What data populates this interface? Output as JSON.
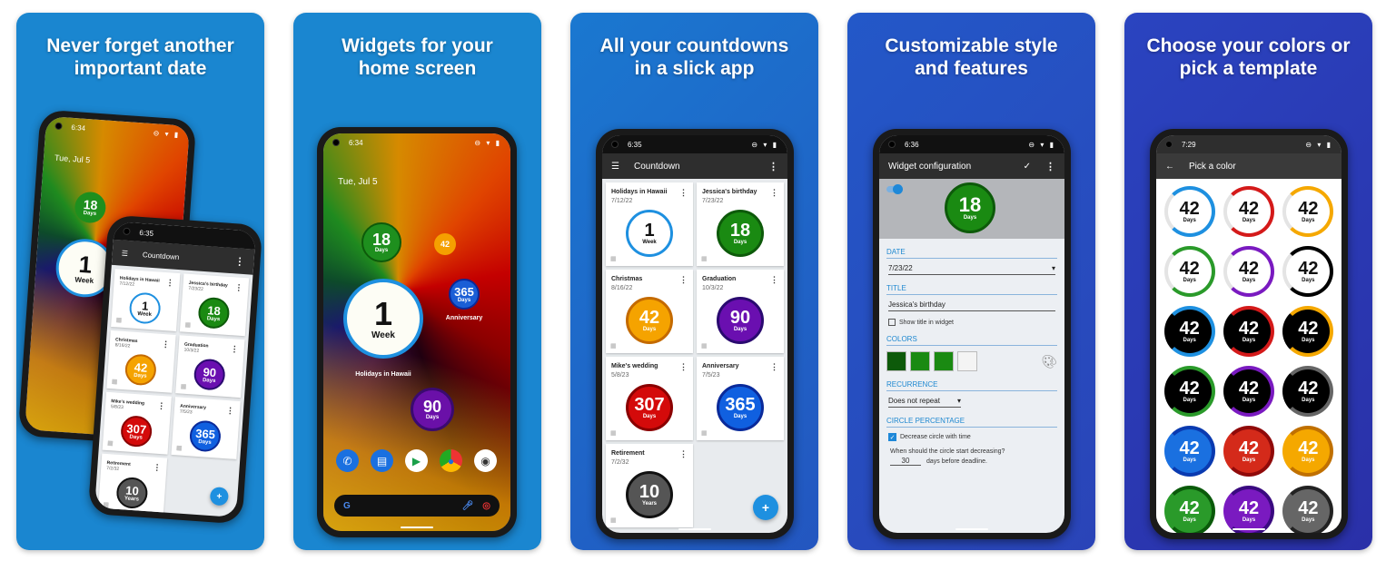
{
  "panels": [
    {
      "title": "Never forget another\nimportant date",
      "bg": "#1a86d0"
    },
    {
      "title": "Widgets for your\nhome screen",
      "bg": "#1a86d0"
    },
    {
      "title": "All your countdowns\nin a slick app",
      "bg": "#1f6fcc"
    },
    {
      "title": "Customizable style\nand features",
      "bg": "#2650c4"
    },
    {
      "title": "Choose your colors or\npick a template",
      "bg": "#2a3cb6"
    }
  ],
  "home": {
    "time": "6:34",
    "status_icons": "⊖ ▾ ▮",
    "date": "Tue, Jul 5",
    "widgets": [
      {
        "value": "18",
        "unit": "Days",
        "color": "#1e8f1e"
      },
      {
        "value": "42",
        "unit": "Days",
        "color": "#f5a000"
      },
      {
        "value": "1",
        "unit": "Week",
        "color": "#fdfdf5",
        "label": "Holidays in Hawaii"
      },
      {
        "value": "365",
        "unit": "Days",
        "color": "#1a5ed6",
        "label": "Anniversary"
      },
      {
        "value": "90",
        "unit": "Days",
        "color": "#6a10a8"
      }
    ],
    "dock": [
      "phone-icon",
      "messages-icon",
      "play-store-icon",
      "chrome-icon",
      "camera-icon"
    ]
  },
  "app": {
    "time": "6:35",
    "title": "Countdown",
    "menu_icon": "☰",
    "more_icon": "⋮",
    "fab": "+",
    "cards": [
      {
        "title": "Holidays in Hawaii",
        "date": "7/12/22",
        "value": "1",
        "unit": "Week",
        "color": "#ffffff",
        "ring": "#1e90e0",
        "text": "#111"
      },
      {
        "title": "Jessica's birthday",
        "date": "7/23/22",
        "value": "18",
        "unit": "Days",
        "color": "#1a8a12",
        "ring": "#0d5a0a",
        "text": "#fff"
      },
      {
        "title": "Christmas",
        "date": "8/16/22",
        "value": "42",
        "unit": "Days",
        "color": "#f5a300",
        "ring": "#c46a00",
        "text": "#fff"
      },
      {
        "title": "Graduation",
        "date": "10/3/22",
        "value": "90",
        "unit": "Days",
        "color": "#6a0fb0",
        "ring": "#2a0a70",
        "text": "#fff"
      },
      {
        "title": "Mike's wedding",
        "date": "5/8/23",
        "value": "307",
        "unit": "Days",
        "color": "#d40a0a",
        "ring": "#8a0000",
        "text": "#fff"
      },
      {
        "title": "Anniversary",
        "date": "7/5/23",
        "value": "365",
        "unit": "Days",
        "color": "#1060e0",
        "ring": "#0a2a9a",
        "text": "#fff"
      },
      {
        "title": "Retirement",
        "date": "7/2/32",
        "value": "10",
        "unit": "Years",
        "color": "#555555",
        "ring": "#111",
        "text": "#fff"
      }
    ]
  },
  "config": {
    "time": "6:36",
    "title": "Widget configuration",
    "check_icon": "✓",
    "more_icon": "⋮",
    "preview": {
      "value": "18",
      "unit": "Days",
      "color": "#1a8a12"
    },
    "date_label": "DATE",
    "date_value": "7/23/22",
    "title_label": "TITLE",
    "title_value": "Jessica's birthday",
    "show_title": "Show title in widget",
    "colors_label": "COLORS",
    "swatches": [
      "#0d5a0a",
      "#1a8a12",
      "#1a8a12",
      "#f4f4f4"
    ],
    "recurrence_label": "RECURRENCE",
    "recurrence_value": "Does not repeat",
    "circle_label": "CIRCLE PERCENTAGE",
    "decrease_label": "Decrease circle with time",
    "question": "When should the circle start decreasing?",
    "days_value": "30",
    "days_suffix": "days before deadline."
  },
  "picker": {
    "time": "7:29",
    "title": "Pick a color",
    "back_icon": "←",
    "items": [
      {
        "value": "42",
        "unit": "Days",
        "bg": "#ffffff",
        "ring": "#1e90e0",
        "text": "#111"
      },
      {
        "value": "42",
        "unit": "Days",
        "bg": "#ffffff",
        "ring": "#d41a1a",
        "text": "#111"
      },
      {
        "value": "42",
        "unit": "Days",
        "bg": "#ffffff",
        "ring": "#f5a800",
        "text": "#111"
      },
      {
        "value": "42",
        "unit": "Days",
        "bg": "#ffffff",
        "ring": "#2a9a2a",
        "text": "#111"
      },
      {
        "value": "42",
        "unit": "Days",
        "bg": "#ffffff",
        "ring": "#7a1ac0",
        "text": "#111"
      },
      {
        "value": "42",
        "unit": "Days",
        "bg": "#ffffff",
        "ring": "#000000",
        "text": "#111"
      },
      {
        "value": "42",
        "unit": "Days",
        "bg": "#000000",
        "ring": "#1e90e0",
        "text": "#fff"
      },
      {
        "value": "42",
        "unit": "Days",
        "bg": "#000000",
        "ring": "#d41a1a",
        "text": "#fff"
      },
      {
        "value": "42",
        "unit": "Days",
        "bg": "#000000",
        "ring": "#f5a800",
        "text": "#fff"
      },
      {
        "value": "42",
        "unit": "Days",
        "bg": "#000000",
        "ring": "#2a9a2a",
        "text": "#fff"
      },
      {
        "value": "42",
        "unit": "Days",
        "bg": "#000000",
        "ring": "#7a1ac0",
        "text": "#fff"
      },
      {
        "value": "42",
        "unit": "Days",
        "bg": "#000000",
        "ring": "#666666",
        "text": "#fff"
      },
      {
        "value": "42",
        "unit": "Days",
        "bg": "#1a70e0",
        "ring": "#0a3ab0",
        "text": "#fff"
      },
      {
        "value": "42",
        "unit": "Days",
        "bg": "#d42a1a",
        "ring": "#900a0a",
        "text": "#fff"
      },
      {
        "value": "42",
        "unit": "Days",
        "bg": "#f5a800",
        "ring": "#c07000",
        "text": "#fff"
      },
      {
        "value": "42",
        "unit": "Days",
        "bg": "#2a9a2a",
        "ring": "#0a5a0a",
        "text": "#fff"
      },
      {
        "value": "42",
        "unit": "Days",
        "bg": "#7a1ac0",
        "ring": "#3a0a80",
        "text": "#fff"
      },
      {
        "value": "42",
        "unit": "Days",
        "bg": "#666666",
        "ring": "#222222",
        "text": "#fff"
      }
    ]
  }
}
